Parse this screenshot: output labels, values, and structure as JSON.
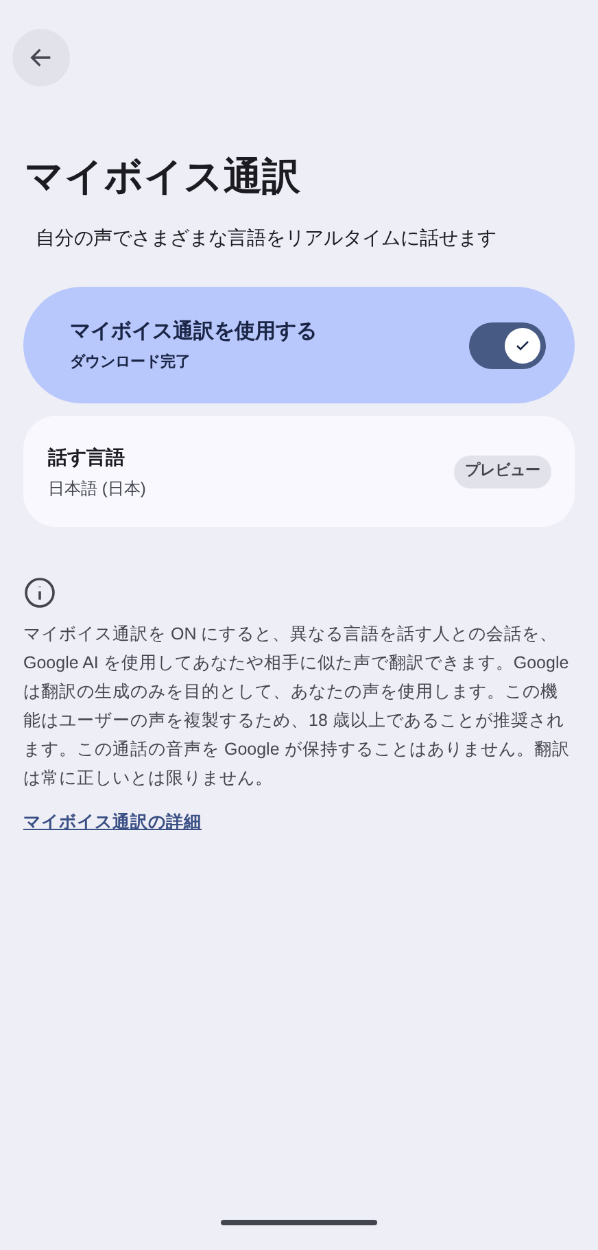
{
  "title": "マイボイス通訳",
  "subtitle": "自分の声でさまざまな言語をリアルタイムに話せます",
  "main_toggle": {
    "label": "マイボイス通訳を使用する",
    "summary": "ダウンロード完了",
    "on": true
  },
  "language": {
    "label": "話す言語",
    "value": "日本語 (日本)",
    "button": "プレビュー"
  },
  "info": {
    "text": "マイボイス通訳を ON にすると、異なる言語を話す人との会話を、Google AI を使用してあなたや相手に似た声で翻訳できます。Google は翻訳の生成のみを目的として、あなたの声を使用します。この機能はユーザーの声を複製するため、18 歳以上であることが推奨されます。この通話の音声を Google が保持することはありません。翻訳は常に正しいとは限りません。",
    "link": "マイボイス通訳の詳細"
  }
}
